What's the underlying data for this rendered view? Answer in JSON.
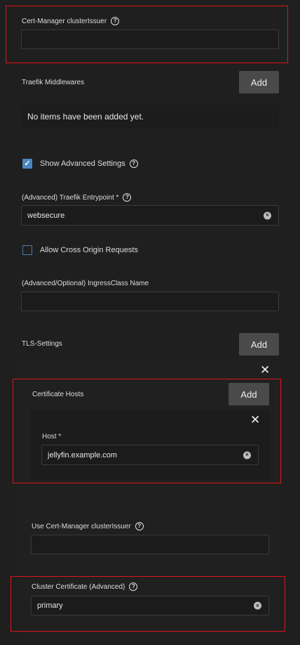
{
  "cert_manager": {
    "label": "Cert-Manager clusterIssuer",
    "value": ""
  },
  "traefik_middlewares": {
    "label": "Traefik Middlewares",
    "add_label": "Add",
    "empty_text": "No items have been added yet."
  },
  "advanced": {
    "label": "Show Advanced Settings",
    "checked": true
  },
  "entrypoint": {
    "label": "(Advanced) Traefik Entrypoint *",
    "value": "websecure"
  },
  "cors": {
    "label": "Allow Cross Origin Requests",
    "checked": false
  },
  "ingress_class": {
    "label": "(Advanced/Optional) IngressClass Name",
    "value": ""
  },
  "tls": {
    "label": "TLS-Settings",
    "add_label": "Add",
    "certificate_hosts": {
      "label": "Certificate Hosts",
      "add_label": "Add"
    },
    "host": {
      "label": "Host *",
      "value": "jellyfin.example.com"
    },
    "use_cert_manager": {
      "label": "Use Cert-Manager clusterIssuer",
      "value": ""
    },
    "cluster_certificate": {
      "label": "Cluster Certificate (Advanced)",
      "value": "primary"
    }
  },
  "icons": {
    "help": "?",
    "clear": "×",
    "close": "✕",
    "check": "✓"
  }
}
